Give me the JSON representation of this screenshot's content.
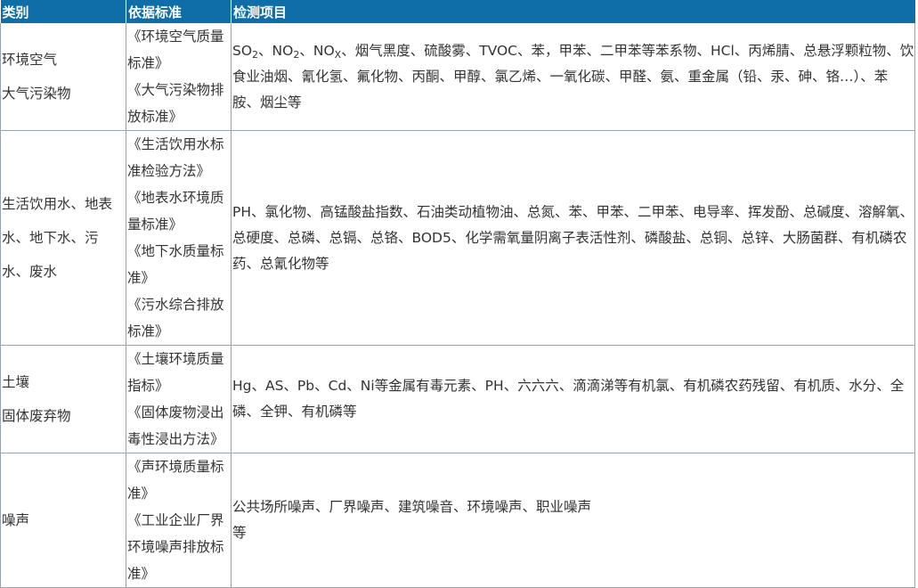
{
  "table": {
    "headers": [
      "类别",
      "依据标准",
      "检测项目"
    ],
    "rows": [
      {
        "category": [
          "环境空气",
          "大气污染物"
        ],
        "standards": [
          "《环境空气质量标准》",
          "《大气污染物排放标准》"
        ],
        "items_parts": [
          "SO",
          "2",
          "、NO",
          "2",
          "、NO",
          "X",
          "、烟气黑度、硫酸雾、TVOC、苯，甲苯、二甲苯等苯系物、HCl、丙烯腈、总悬浮颗粒物、饮食业油烟、氰化氢、氟化物、丙酮、甲醇、氯乙烯、一氧化碳、甲醛、氨、重金属（铅、汞、砷、铬…）、苯胺、烟尘等"
        ]
      },
      {
        "category": [
          "生活饮用水、地表水、地下水、污水、废水"
        ],
        "standards": [
          "《生活饮用水标准检验方法》",
          "《地表水环境质量标准》",
          "《地下水质量标准》",
          "《污水综合排放标准》"
        ],
        "items": "PH、氯化物、高锰酸盐指数、石油类动植物油、总氮、苯、甲苯、二甲苯、电导率、挥发酚、总碱度、溶解氧、总硬度、总磷、总镉、总铬、BOD5、化学需氧量阴离子表活性剂、磷酸盐、总铜、总锌、大肠菌群、有机磷农药、总氰化物等"
      },
      {
        "category": [
          "土壤",
          "固体废弃物"
        ],
        "standards": [
          "《土壤环境质量指标》",
          "《固体废物浸出毒性浸出方法》"
        ],
        "items": "Hg、AS、Pb、Cd、Ni等金属有毒元素、PH、六六六、滴滴涕等有机氯、有机磷农药残留、有机质、水分、全磷、全钾、有机磷等"
      },
      {
        "category": [
          "噪声"
        ],
        "standards": [
          "《声环境质量标准》",
          "《工业企业厂界环境噪声排放标准》"
        ],
        "items_lines": [
          "公共场所噪声、厂界噪声、建筑噪音、环境噪声、职业噪声",
          "等"
        ]
      }
    ]
  }
}
